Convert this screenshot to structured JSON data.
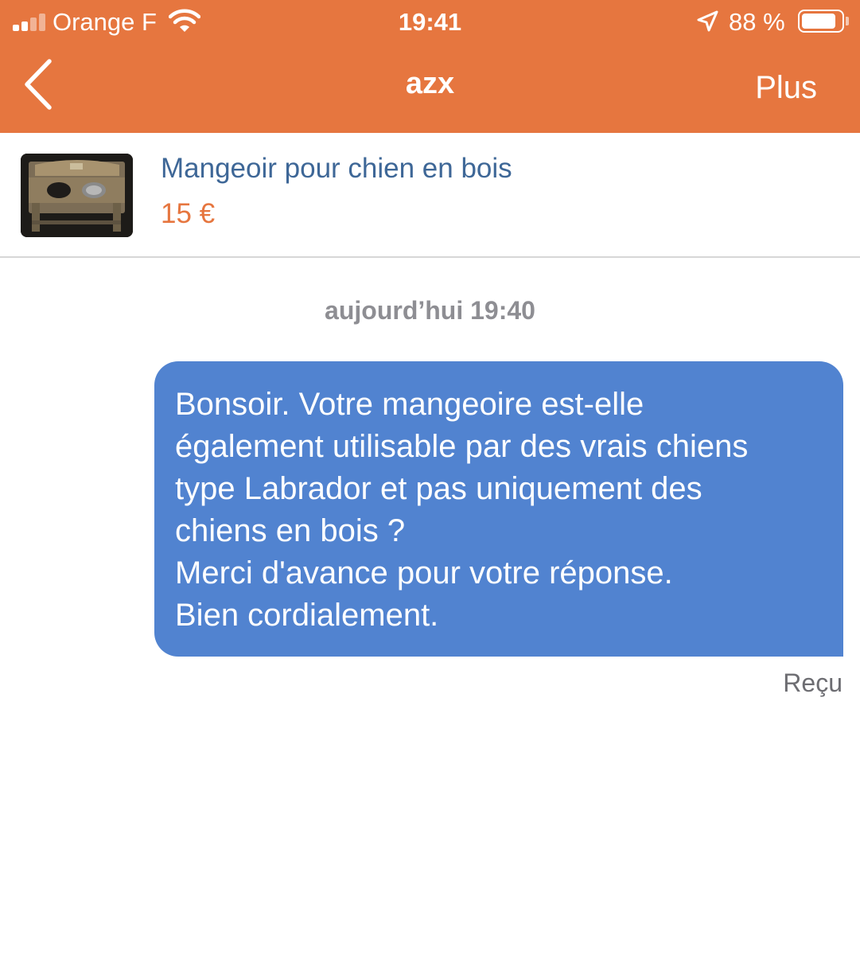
{
  "status_bar": {
    "carrier": "Orange F",
    "time": "19:41",
    "battery_percent": "88 %",
    "battery_level": 0.88,
    "signal_bars": 2,
    "icons": [
      "signal-icon",
      "wifi-icon",
      "location-arrow-icon",
      "battery-icon"
    ]
  },
  "nav": {
    "title": "azx",
    "more_label": "Plus",
    "back_icon": "chevron-left-icon"
  },
  "listing": {
    "title": "Mangeoir pour chien en bois",
    "price": "15 €"
  },
  "conversation": {
    "timestamp": "aujourd’hui 19:40",
    "messages": [
      {
        "lines": [
          "Bonsoir. Votre mangeoire est-elle",
          "également utilisable par des vrais chiens",
          "type Labrador et pas uniquement des",
          "chiens en bois ?",
          "Merci d'avance pour votre réponse.",
          "Bien cordialement."
        ],
        "status": "Reçu"
      }
    ]
  },
  "colors": {
    "header": "#e6763f",
    "bubble": "#5183d0",
    "listing_title": "#3e6797",
    "price": "#e6763f"
  }
}
